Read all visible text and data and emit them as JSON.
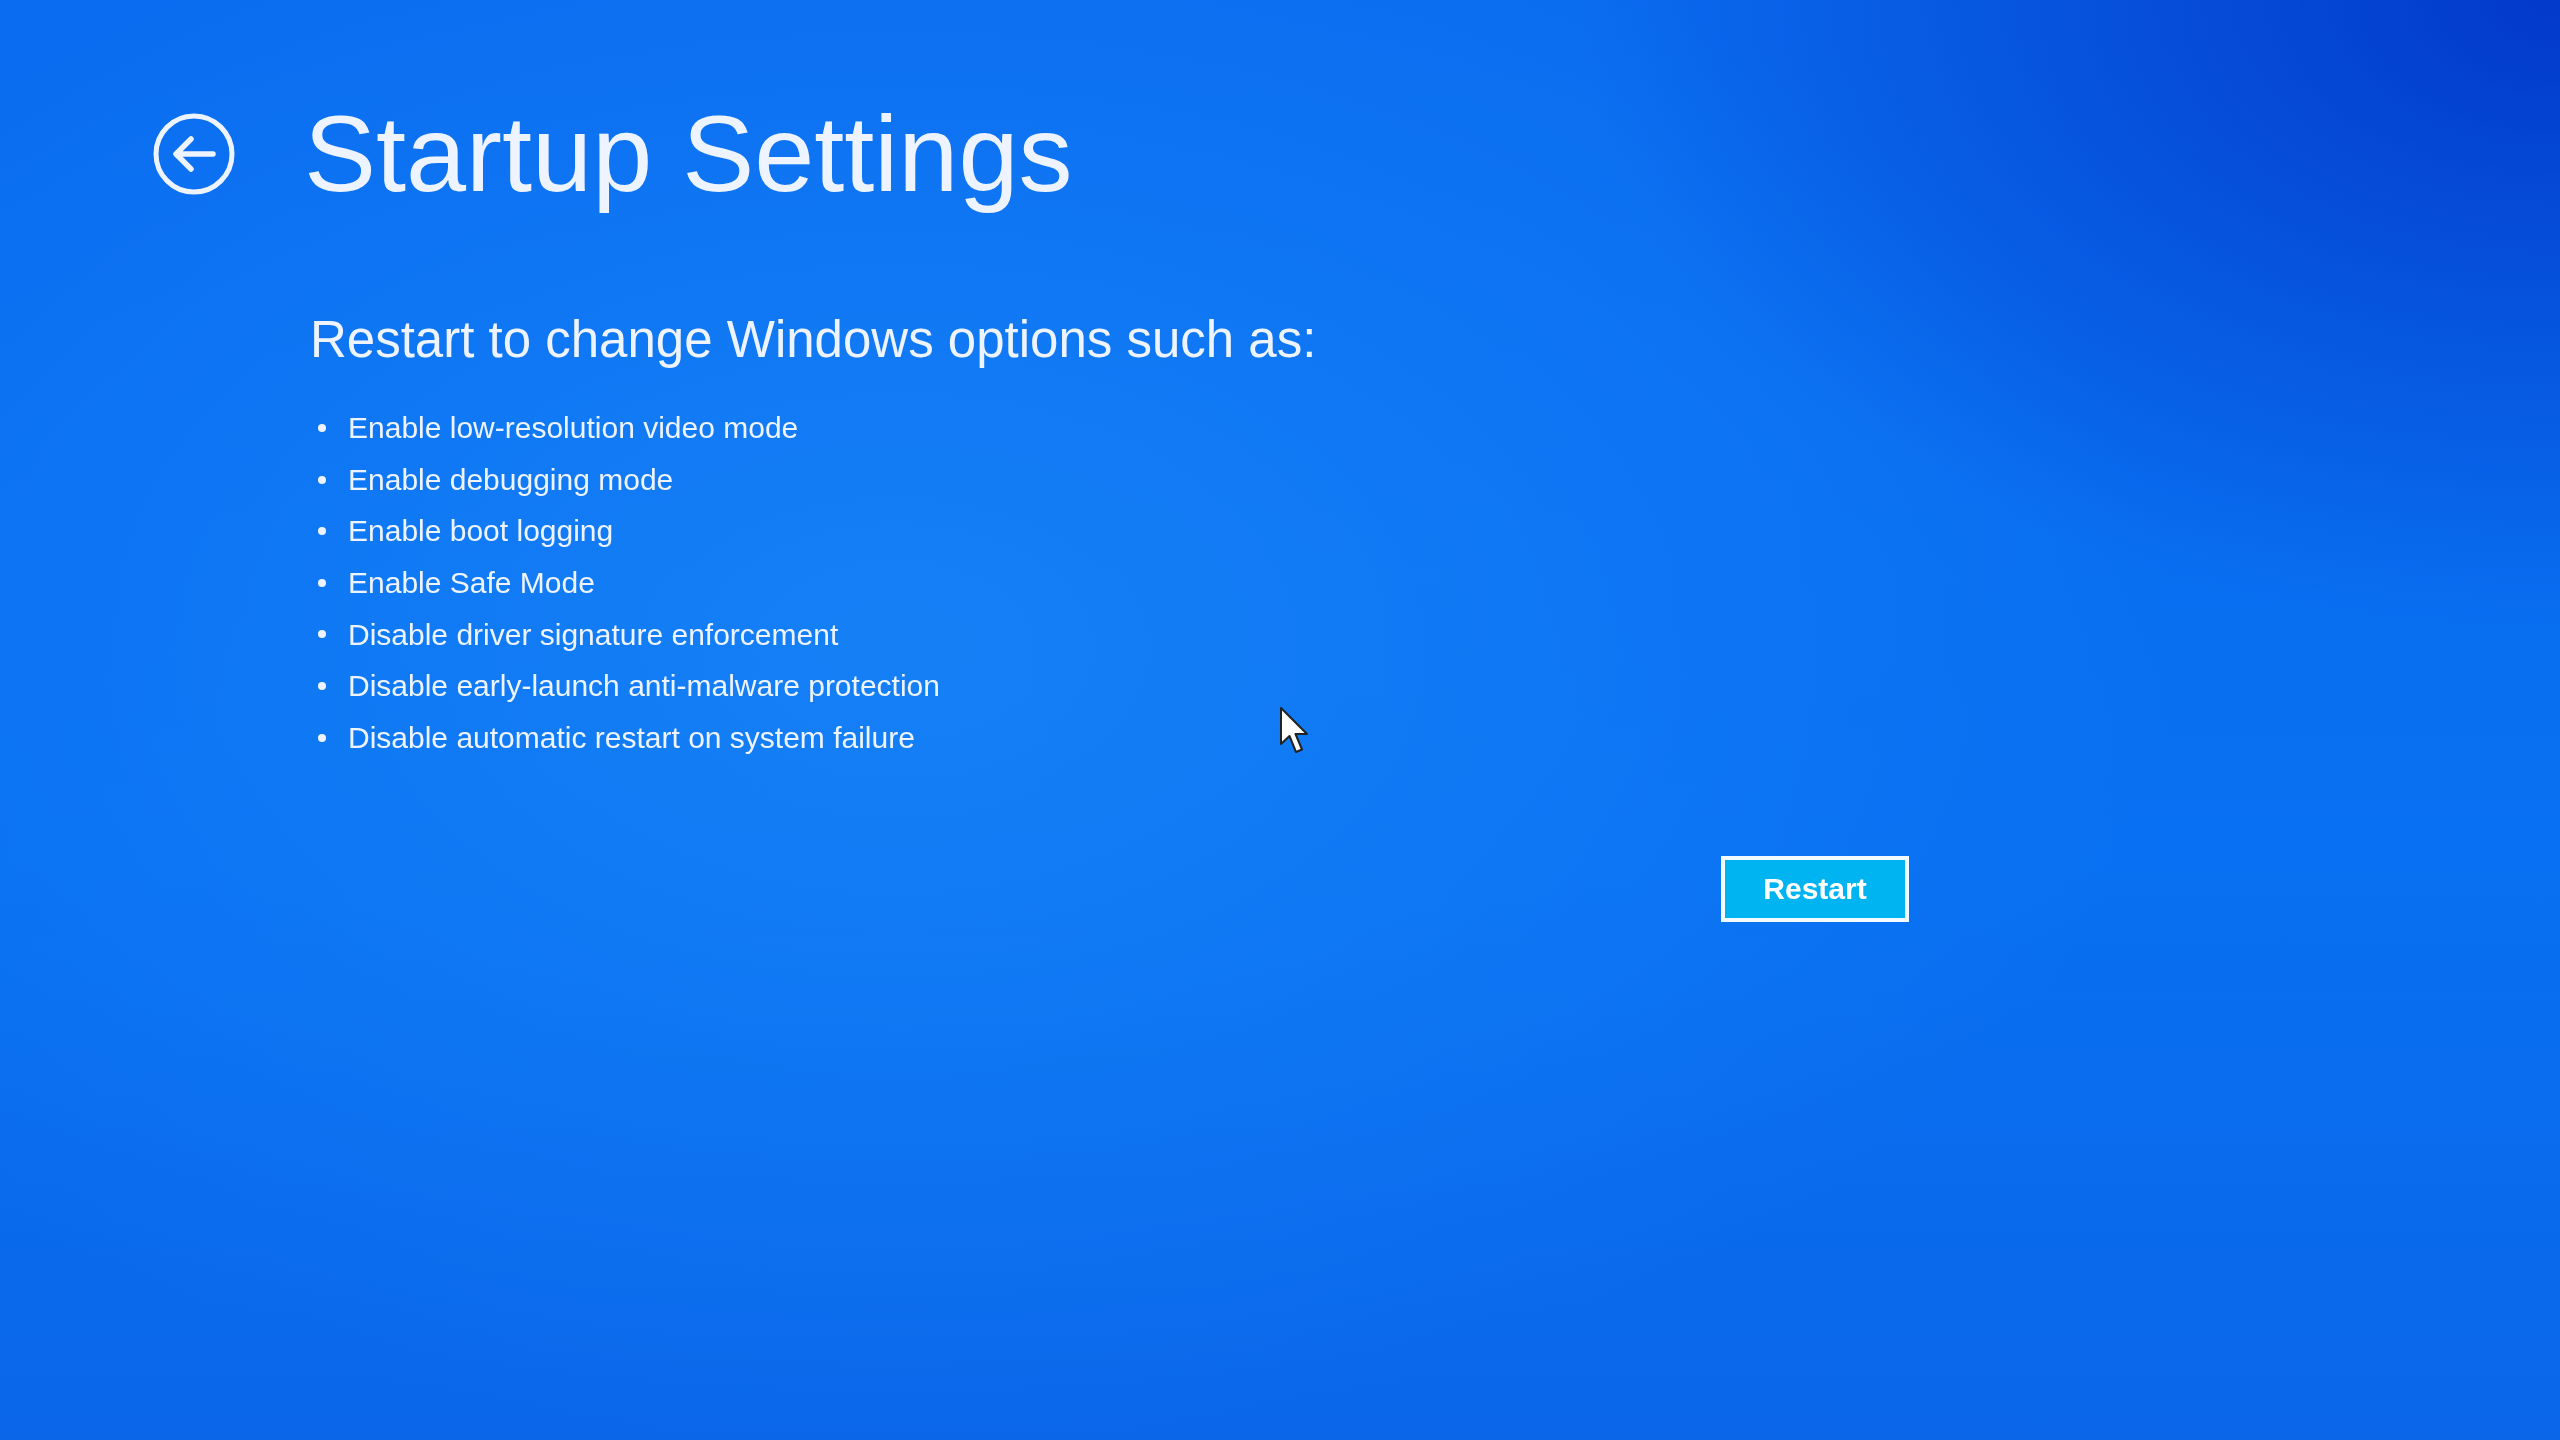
{
  "title": "Startup Settings",
  "subtitle": "Restart to change Windows options such as:",
  "options": [
    "Enable low-resolution video mode",
    "Enable debugging mode",
    "Enable boot logging",
    "Enable Safe Mode",
    "Disable driver signature enforcement",
    "Disable early-launch anti-malware protection",
    "Disable automatic restart on system failure"
  ],
  "restart_button": {
    "label": "Restart"
  }
}
